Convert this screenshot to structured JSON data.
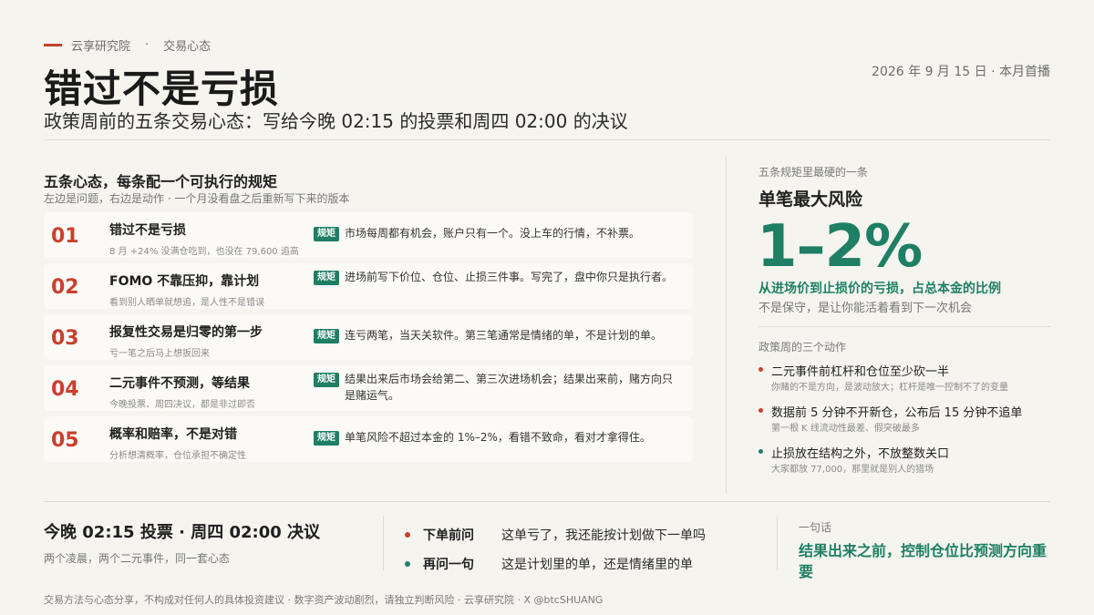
{
  "header": {
    "brand": "云享研究院",
    "section": "交易心态",
    "title": "错过不是亏损",
    "subtitle": "政策周前的五条交易心态：写给今晚 02:15 的投票和周四 02:00 的决议",
    "date": "2026 年 9 月 15 日 · 本月首播",
    "dot": "·"
  },
  "left": {
    "title": "五条心态，每条配一个可执行的规矩",
    "subtitle": "左边是问题，右边是动作 · 一个月没看盘之后重新写下来的版本",
    "badge": "规矩",
    "items": [
      {
        "num": "01",
        "head": "错过不是亏损",
        "sub": "8 月 +24% 没满仓吃到，也没在 79,600 追高",
        "rule": "市场每周都有机会，账户只有一个。没上车的行情，不补票。"
      },
      {
        "num": "02",
        "head": "FOMO 不靠压抑，靠计划",
        "sub": "看到别人晒单就想追，是人性不是错误",
        "rule": "进场前写下价位、仓位、止损三件事。写完了，盘中你只是执行者。"
      },
      {
        "num": "03",
        "head": "报复性交易是归零的第一步",
        "sub": "亏一笔之后马上想扳回来",
        "rule": "连亏两笔，当天关软件。第三笔通常是情绪的单，不是计划的单。"
      },
      {
        "num": "04",
        "head": "二元事件不预测，等结果",
        "sub": "今晚投票、周四决议，都是非过即否",
        "rule": "结果出来后市场会给第二、第三次进场机会；结果出来前，赌方向只是赌运气。"
      },
      {
        "num": "05",
        "head": "概率和赔率，不是对错",
        "sub": "分析想清概率，仓位承担不确定性",
        "rule": "单笔风险不超过本金的 1%–2%，看错不致命，看对才拿得住。"
      }
    ]
  },
  "right": {
    "label": "五条规矩里最硬的一条",
    "head": "单笔最大风险",
    "big": "1–2%",
    "desc": "从进场价到止损价的亏损，占总本金的比例",
    "note": "不是保守，是让你能活着看到下一次机会",
    "actions_label": "政策周的三个动作",
    "actions": [
      {
        "head": "二元事件前杠杆和仓位至少砍一半",
        "sub": "你赌的不是方向，是波动放大；杠杆是唯一控制不了的变量",
        "color": "#c8412d"
      },
      {
        "head": "数据前 5 分钟不开新仓，公布后 15 分钟不追单",
        "sub": "第一根 K 线流动性最差、假突破最多",
        "color": "#c8412d"
      },
      {
        "head": "止损放在结构之外，不放整数关口",
        "sub": "大家都放 77,000，那里就是别人的猎场",
        "color": "#1e7f64"
      }
    ]
  },
  "bottom": {
    "title": "今晚 02:15 投票 · 周四 02:00 决议",
    "sub": "两个凌晨，两个二元事件，同一套心态",
    "questions": [
      {
        "k": "下单前问",
        "v": "这单亏了，我还能按计划做下一单吗",
        "color": "#c8412d"
      },
      {
        "k": "再问一句",
        "v": "这是计划里的单，还是情绪里的单",
        "color": "#1e7f64"
      }
    ],
    "one_label": "一句话",
    "one": "结果出来之前，控制仓位比预测方向重要"
  },
  "footer": "交易方法与心态分享，不构成对任何人的具体投资建议 · 数字资产波动剧烈，请独立判断风险 · 云享研究院 · X @btcSHUANG",
  "colors": {
    "accent_red": "#c8412d",
    "accent_green": "#1e7f64",
    "background": "#f5f4ef"
  }
}
